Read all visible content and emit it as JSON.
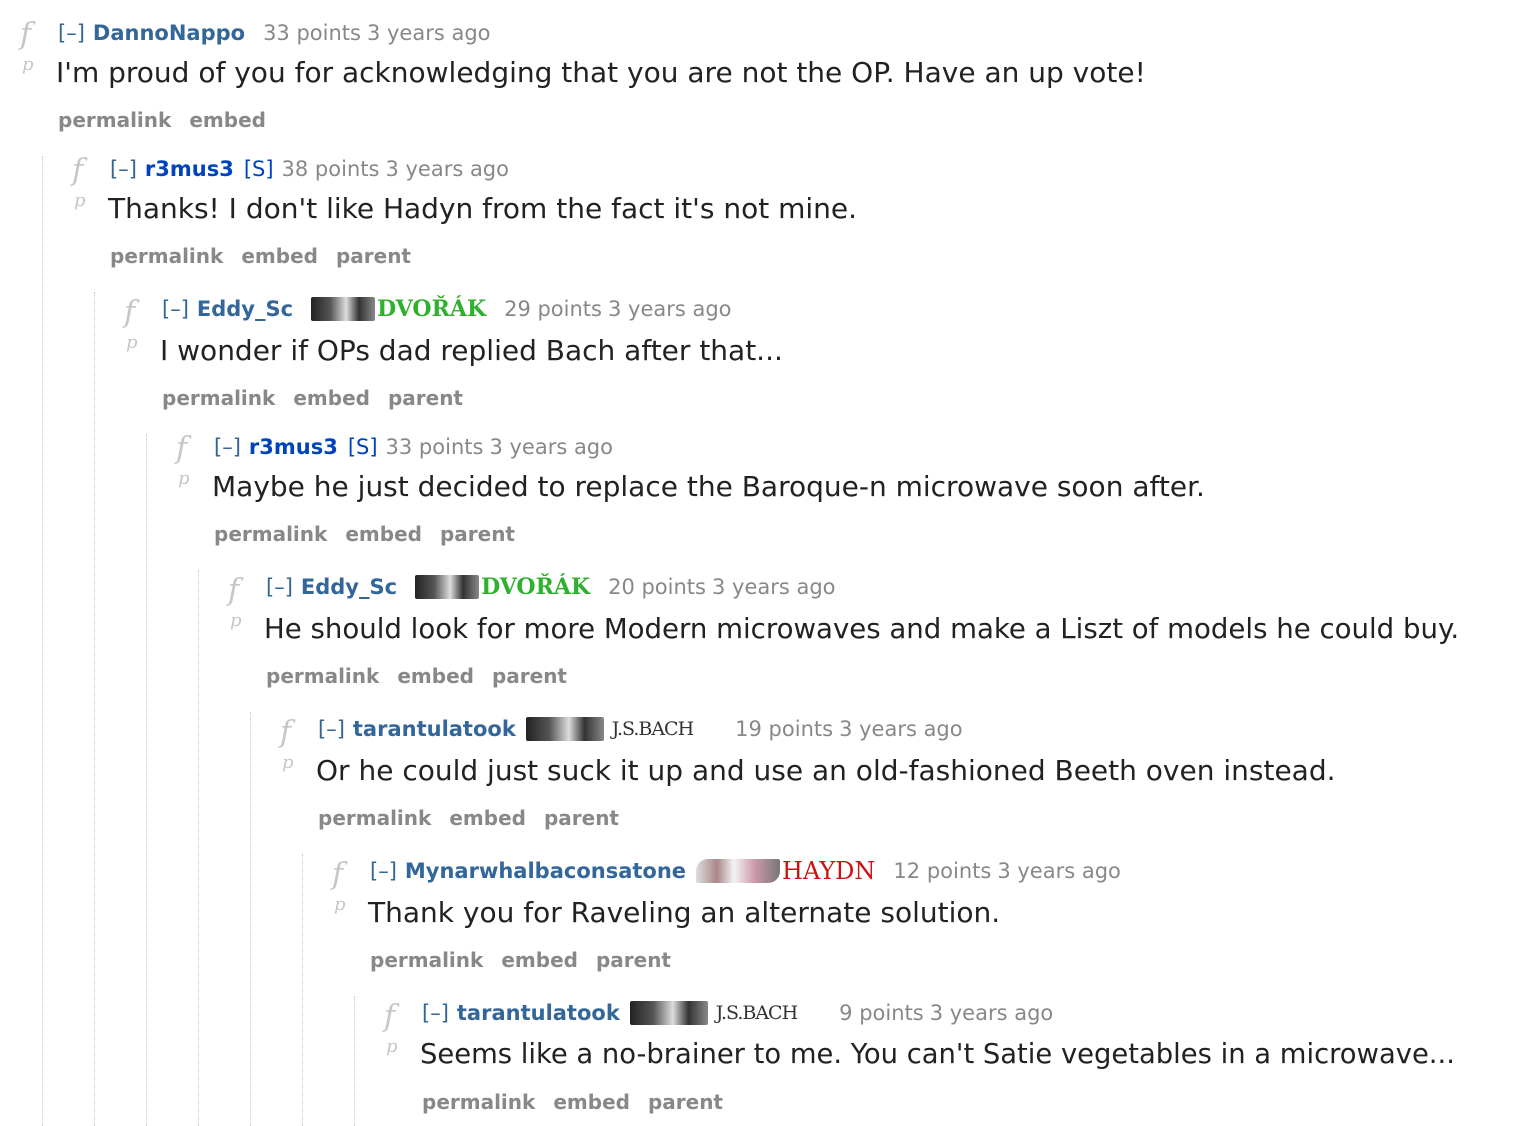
{
  "comments": [
    {
      "expand": "[–]",
      "author": "DannoNappo",
      "submitter": "",
      "flair": "",
      "score": "33 points",
      "time": "3 years ago",
      "text": "I'm proud of you for acknowledging that you are not the OP. Have an up vote!",
      "buttons": [
        "permalink",
        "embed"
      ]
    },
    {
      "expand": "[–]",
      "author": "r3mus3",
      "submitter": "[S]",
      "flair": "",
      "score": "38 points",
      "time": "3 years ago",
      "text": "Thanks! I don't like Hadyn from the fact it's not mine.",
      "buttons": [
        "permalink",
        "embed",
        "parent"
      ]
    },
    {
      "expand": "[–]",
      "author": "Eddy_Sc",
      "submitter": "",
      "flair": "DVOŘÁK",
      "score": "29 points",
      "time": "3 years ago",
      "text": "I wonder if OPs dad replied Bach after that...",
      "buttons": [
        "permalink",
        "embed",
        "parent"
      ]
    },
    {
      "expand": "[–]",
      "author": "r3mus3",
      "submitter": "[S]",
      "flair": "",
      "score": "33 points",
      "time": "3 years ago",
      "text": "Maybe he just decided to replace the Baroque-n microwave soon after.",
      "buttons": [
        "permalink",
        "embed",
        "parent"
      ]
    },
    {
      "expand": "[–]",
      "author": "Eddy_Sc",
      "submitter": "",
      "flair": "DVOŘÁK",
      "score": "20 points",
      "time": "3 years ago",
      "text": "He should look for more Modern microwaves and make a Liszt of models he could buy.",
      "buttons": [
        "permalink",
        "embed",
        "parent"
      ]
    },
    {
      "expand": "[–]",
      "author": "tarantulatook",
      "submitter": "",
      "flair": "J.S.BACH",
      "score": "19 points",
      "time": "3 years ago",
      "text": "Or he could just suck it up and use an old-fashioned Beeth oven instead.",
      "buttons": [
        "permalink",
        "embed",
        "parent"
      ]
    },
    {
      "expand": "[–]",
      "author": "Mynarwhalbaconsatone",
      "submitter": "",
      "flair": "HAYDN",
      "score": "12 points",
      "time": "3 years ago",
      "text": "Thank you for Raveling an alternate solution.",
      "buttons": [
        "permalink",
        "embed",
        "parent"
      ]
    },
    {
      "expand": "[–]",
      "author": "tarantulatook",
      "submitter": "",
      "flair": "J.S.BACH",
      "score": "9 points",
      "time": "3 years ago",
      "text": "Seems like a no-brainer to me. You can't Satie vegetables in a microwave...",
      "buttons": [
        "permalink",
        "embed",
        "parent"
      ]
    }
  ],
  "icons": {
    "upvote": "f",
    "downvote": "p"
  },
  "colors": {
    "author": "#336699",
    "submitter": "#0044bb",
    "meta": "#888888",
    "flair_green": "#2fb02f",
    "flair_red": "#d01010"
  }
}
